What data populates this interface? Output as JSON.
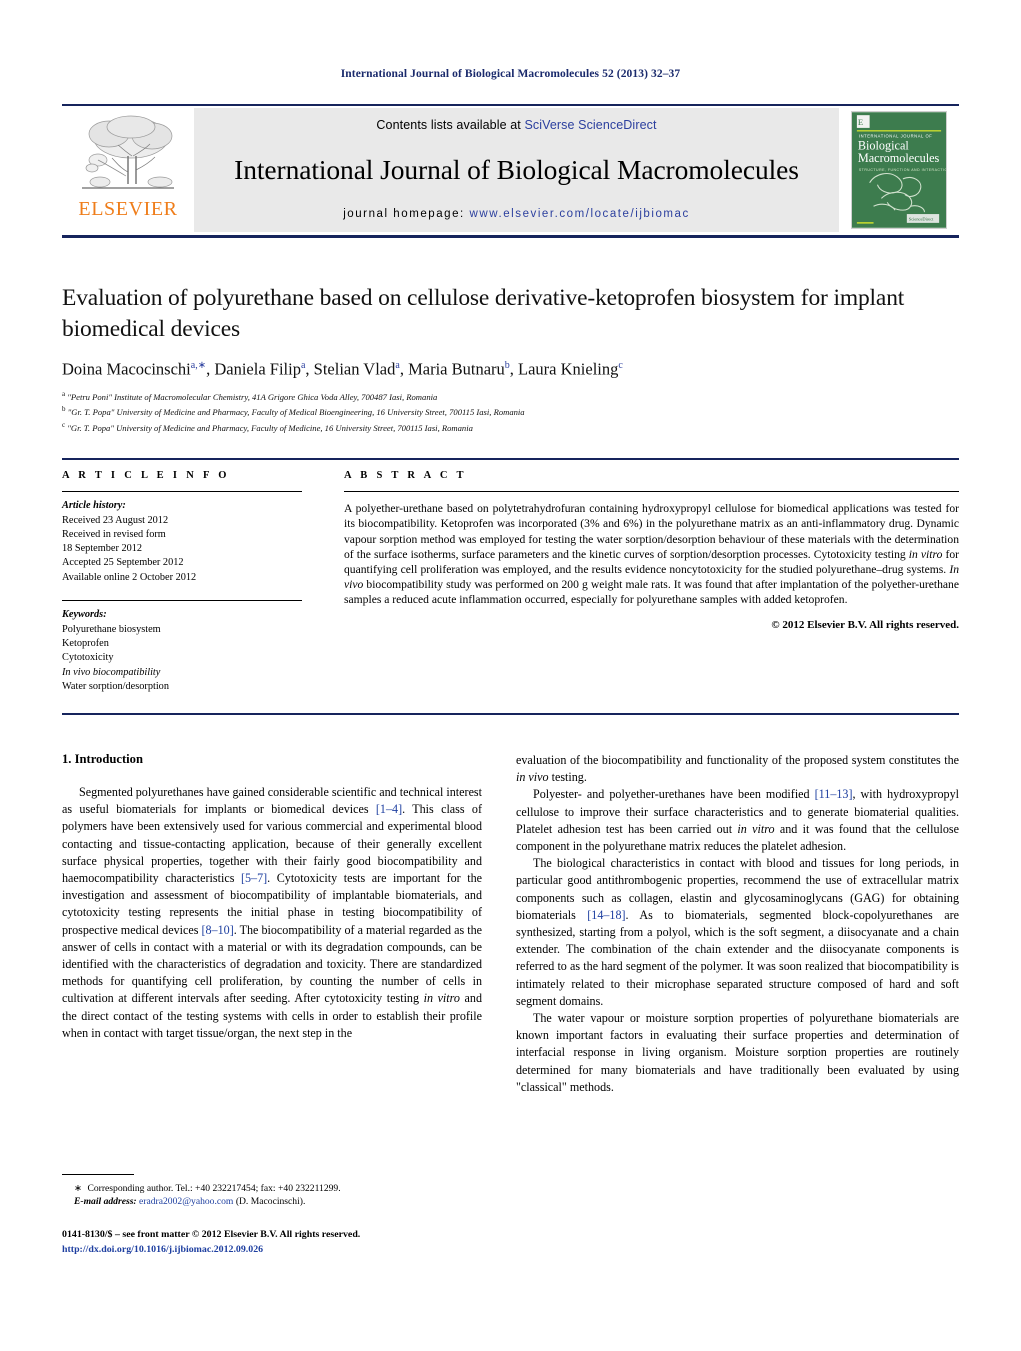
{
  "running_head": "International Journal of Biological Macromolecules 52 (2013) 32–37",
  "masthead": {
    "contents_prefix": "Contents lists available at ",
    "contents_link": "SciVerse ScienceDirect",
    "journal_name": "International Journal of Biological Macromolecules",
    "homepage_label": "journal homepage: ",
    "homepage_url": "www.elsevier.com/locate/ijbiomac",
    "publisher_logo_text": "ELSEVIER",
    "publisher_accent_color": "#ef7d1a",
    "link_color": "#2b3f9e",
    "band_color": "#e9e9e9",
    "rule_color": "#16245c",
    "cover": {
      "top_label": "INTERNATIONAL JOURNAL OF",
      "title_line1": "Biological",
      "title_line2": "Macromolecules",
      "subtitle": "STRUCTURE, FUNCTION AND INTERACTIONS",
      "background_color": "#3d7c4e"
    }
  },
  "article": {
    "title": "Evaluation of polyurethane based on cellulose derivative-ketoprofen biosystem for implant biomedical devices",
    "authors_html": "Doina Macocinschi<sup>a,∗</sup>, Daniela Filip<sup>a</sup>, Stelian Vlad<sup>a</sup>, Maria Butnaru<sup>b</sup>, Laura Knieling<sup>c</sup>",
    "affiliations": [
      {
        "mark": "a",
        "text": "\"Petru Poni\" Institute of Macromolecular Chemistry, 41A Grigore Ghica Voda Alley, 700487 Iasi, Romania"
      },
      {
        "mark": "b",
        "text": "\"Gr. T. Popa\" University of Medicine and Pharmacy, Faculty of Medical Bioengineering, 16 University Street, 700115 Iasi, Romania"
      },
      {
        "mark": "c",
        "text": "\"Gr. T. Popa\" University of Medicine and Pharmacy, Faculty of Medicine, 16 University Street, 700115 Iasi, Romania"
      }
    ]
  },
  "article_info": {
    "heading": "A R T I C L E    I N F O",
    "history_label": "Article history:",
    "history": [
      "Received 23 August 2012",
      "Received in revised form",
      "18 September 2012",
      "Accepted 25 September 2012",
      "Available online 2 October 2012"
    ],
    "keywords_label": "Keywords:",
    "keywords": [
      "Polyurethane biosystem",
      "Ketoprofen",
      "Cytotoxicity",
      "In vivo biocompatibility",
      "Water sorption/desorption"
    ]
  },
  "abstract": {
    "heading": "A B S T R A C T",
    "text_html": "A polyether-urethane based on polytetrahydrofuran containing hydroxypropyl cellulose for biomedical applications was tested for its biocompatibility. Ketoprofen was incorporated (3% and 6%) in the polyurethane matrix as an anti-inflammatory drug. Dynamic vapour sorption method was employed for testing the water sorption/desorption behaviour of these materials with the determination of the surface isotherms, surface parameters and the kinetic curves of sorption/desorption processes. Cytotoxicity testing <i>in vitro</i> for quantifying cell proliferation was employed, and the results evidence noncytotoxicity for the studied polyurethane–drug systems. <i>In vivo</i> biocompatibility study was performed on 200 g weight male rats. It was found that after implantation of the polyether-urethane samples a reduced acute inflammation occurred, especially for polyurethane samples with added ketoprofen.",
    "copyright": "© 2012 Elsevier B.V. All rights reserved."
  },
  "body": {
    "section_title": "1.  Introduction",
    "left_paragraphs_html": [
      "Segmented polyurethanes have gained considerable scientific and technical interest as useful biomaterials for implants or biomedical devices <span class=\"ref\">[1–4]</span>. This class of polymers have been extensively used for various commercial and experimental blood contacting and tissue-contacting application, because of their generally excellent surface physical properties, together with their fairly good biocompatibility and haemocompatibility characteristics <span class=\"ref\">[5–7]</span>. Cytotoxicity tests are important for the investigation and assessment of biocompatibility of implantable biomaterials, and cytotoxicity testing represents the initial phase in testing biocompatibility of prospective medical devices <span class=\"ref\">[8–10]</span>. The biocompatibility of a material regarded as the answer of cells in contact with a material or with its degradation compounds, can be identified with the characteristics of degradation and toxicity. There are standardized methods for quantifying cell proliferation, by counting the number of cells in cultivation at different intervals after seeding. After cytotoxicity testing <i>in vitro</i> and the direct contact of the testing systems with cells in order to establish their profile when in contact with target tissue/organ, the next step in the"
    ],
    "right_paragraphs_html": [
      "evaluation of the biocompatibility and functionality of the proposed system constitutes the <i>in vivo</i> testing.",
      "Polyester- and polyether-urethanes have been modified <span class=\"ref\">[11–13]</span>, with hydroxypropyl cellulose to improve their surface characteristics and to generate biomaterial qualities. Platelet adhesion test has been carried out <i>in vitro</i> and it was found that the cellulose component in the polyurethane matrix reduces the platelet adhesion.",
      "The biological characteristics in contact with blood and tissues for long periods, in particular good antithrombogenic properties, recommend the use of extracellular matrix components such as collagen, elastin and glycosaminoglycans (GAG) for obtaining biomaterials <span class=\"ref\">[14–18]</span>. As to biomaterials, segmented block-copolyurethanes are synthesized, starting from a polyol, which is the soft segment, a diisocyanate and a chain extender. The combination of the chain extender and the diisocyanate components is referred to as the hard segment of the polymer. It was soon realized that biocompatibility is intimately related to their microphase separated structure composed of hard and soft segment domains.",
      "The water vapour or moisture sorption properties of polyurethane biomaterials are known important factors in evaluating their surface properties and determination of interfacial response in living organism. Moisture sorption properties are routinely determined for many biomaterials and have traditionally been evaluated by using \"classical\" methods."
    ]
  },
  "footnote": {
    "corresponding_html": "<span class=\"fn-star\">∗</span> Corresponding author. Tel.: +40 232217454; fax: +40 232211299.",
    "email_label": "E-mail address:",
    "email": "eradra2002@yahoo.com",
    "email_suffix": "(D. Macocinschi)."
  },
  "bottom": {
    "front_matter": "0141-8130/$ – see front matter © 2012 Elsevier B.V. All rights reserved.",
    "doi": "http://dx.doi.org/10.1016/j.ijbiomac.2012.09.026"
  }
}
